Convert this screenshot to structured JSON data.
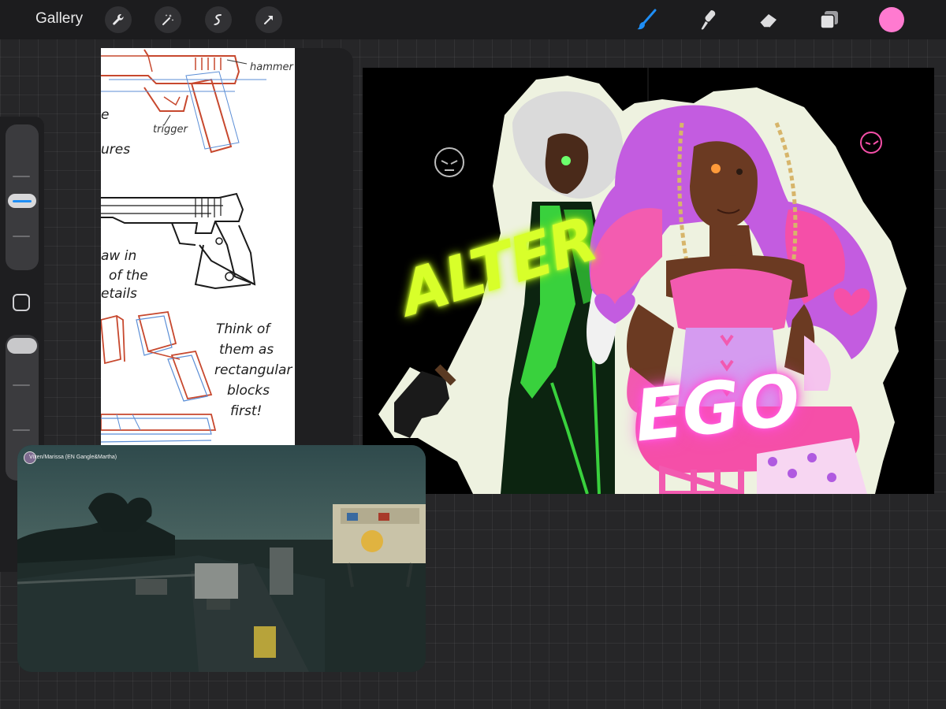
{
  "toolbar": {
    "gallery_label": "Gallery",
    "left_tools": [
      "wrench-icon",
      "magic-wand-icon",
      "selection-icon",
      "transform-arrow-icon"
    ],
    "right_tools": [
      "brush-icon",
      "smudge-icon",
      "eraser-icon",
      "layers-icon"
    ],
    "active_tool": "brush-icon",
    "active_color": "#ff7ad0",
    "accent_color": "#1f8ef5"
  },
  "sidebar": {
    "brush_size_level": 0.5
  },
  "reference": {
    "labels": {
      "hammer": "hammer",
      "trigger": "trigger",
      "partial_1": "e",
      "partial_2": "ures",
      "partial_3": "aw in",
      "partial_4": "of the",
      "partial_5": "etails",
      "note_1": "Think of",
      "note_2": "them as",
      "note_3": "rectangular",
      "note_4": "blocks",
      "note_5": "first!"
    }
  },
  "canvas": {
    "title_1": "ALTER",
    "title_2": "EGO",
    "title_1_color": "#d8ff2a",
    "title_2_color": "#ffffff",
    "title_2_glow": "#ff4fd8"
  },
  "video": {
    "channel_label": "Vixen/Marissa (EN Gangle&Martha)"
  }
}
